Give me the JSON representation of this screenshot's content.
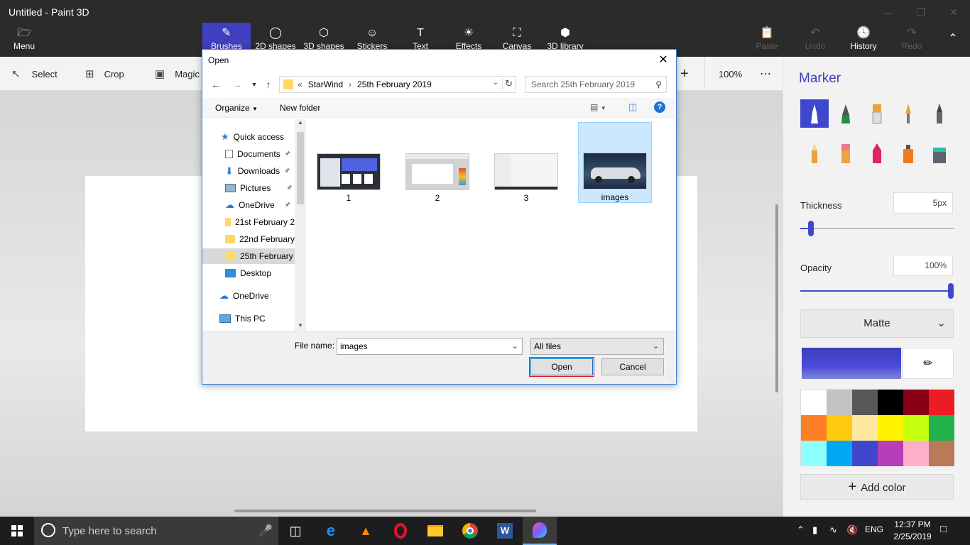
{
  "window": {
    "title": "Untitled - Paint 3D"
  },
  "ribbon": {
    "menu_label": "Menu",
    "tabs": [
      {
        "label": "Brushes",
        "icon": "brush-icon",
        "selected": true
      },
      {
        "label": "2D shapes",
        "icon": "2d-shapes-icon"
      },
      {
        "label": "3D shapes",
        "icon": "3d-shapes-icon"
      },
      {
        "label": "Stickers",
        "icon": "stickers-icon"
      },
      {
        "label": "Text",
        "icon": "text-icon"
      },
      {
        "label": "Effects",
        "icon": "effects-icon"
      },
      {
        "label": "Canvas",
        "icon": "canvas-icon"
      },
      {
        "label": "3D library",
        "icon": "3d-library-icon"
      }
    ],
    "actions": [
      {
        "label": "Paste",
        "enabled": false
      },
      {
        "label": "Undo",
        "enabled": false
      },
      {
        "label": "History",
        "enabled": true
      },
      {
        "label": "Redo",
        "enabled": false
      }
    ]
  },
  "toolbar2": {
    "select": "Select",
    "crop": "Crop",
    "magic": "Magic",
    "zoom": "100%"
  },
  "side_panel": {
    "title": "Marker",
    "thickness_label": "Thickness",
    "thickness_value": "5px",
    "thickness_level": 0.05,
    "opacity_label": "Opacity",
    "opacity_value": "100%",
    "opacity_level": 1.0,
    "finish": "Matte",
    "current_color": "#3f48cc",
    "palette": [
      "#ffffff",
      "#c3c3c3",
      "#585858",
      "#000000",
      "#880015",
      "#ed1c24",
      "#ff7f27",
      "#ffc90e",
      "#fde8a0",
      "#fff200",
      "#c4ff0e",
      "#22b14c",
      "#8cfffb",
      "#00a8f3",
      "#3f48cc",
      "#b83dba",
      "#ffaec9",
      "#b97a57"
    ],
    "add_color": "Add color"
  },
  "dialog": {
    "title": "Open",
    "address": {
      "prefix": "«",
      "segments": [
        "StarWind",
        "25th February 2019"
      ]
    },
    "search_placeholder": "Search 25th February 2019",
    "organize": "Organize",
    "new_folder": "New folder",
    "nav": [
      {
        "label": "Quick access",
        "icon": "star-icon",
        "indent": 0
      },
      {
        "label": "Documents",
        "icon": "documents-icon",
        "indent": 1,
        "pinned": true
      },
      {
        "label": "Downloads",
        "icon": "download-icon",
        "indent": 1,
        "pinned": true
      },
      {
        "label": "Pictures",
        "icon": "pictures-icon",
        "indent": 1,
        "pinned": true
      },
      {
        "label": "OneDrive",
        "icon": "onedrive-icon",
        "indent": 1,
        "pinned": true
      },
      {
        "label": "21st February 2",
        "icon": "folder-icon",
        "indent": 1
      },
      {
        "label": "22nd February",
        "icon": "folder-icon",
        "indent": 1
      },
      {
        "label": "25th February",
        "icon": "folder-icon",
        "indent": 1,
        "selected": true
      },
      {
        "label": "Desktop",
        "icon": "desktop-icon",
        "indent": 1
      },
      {
        "label": "OneDrive",
        "icon": "onedrive-icon",
        "indent": 0
      },
      {
        "label": "This PC",
        "icon": "pc-icon",
        "indent": 0
      }
    ],
    "files": [
      {
        "name": "1",
        "thumb": "app-screenshot"
      },
      {
        "name": "2",
        "thumb": "paint-screenshot"
      },
      {
        "name": "3",
        "thumb": "blank-screenshot"
      },
      {
        "name": "images",
        "thumb": "car-photo",
        "selected": true
      }
    ],
    "file_name_label": "File name:",
    "file_name_value": "images",
    "file_type": "All files",
    "open_label": "Open",
    "cancel_label": "Cancel"
  },
  "taskbar": {
    "search_placeholder": "Type here to search",
    "apps": [
      "task-view-icon",
      "edge-icon",
      "vlc-icon",
      "opera-icon",
      "file-explorer-icon",
      "chrome-icon",
      "word-icon",
      "paint3d-icon"
    ],
    "language": "ENG",
    "time": "12:37 PM",
    "date": "2/25/2019"
  }
}
